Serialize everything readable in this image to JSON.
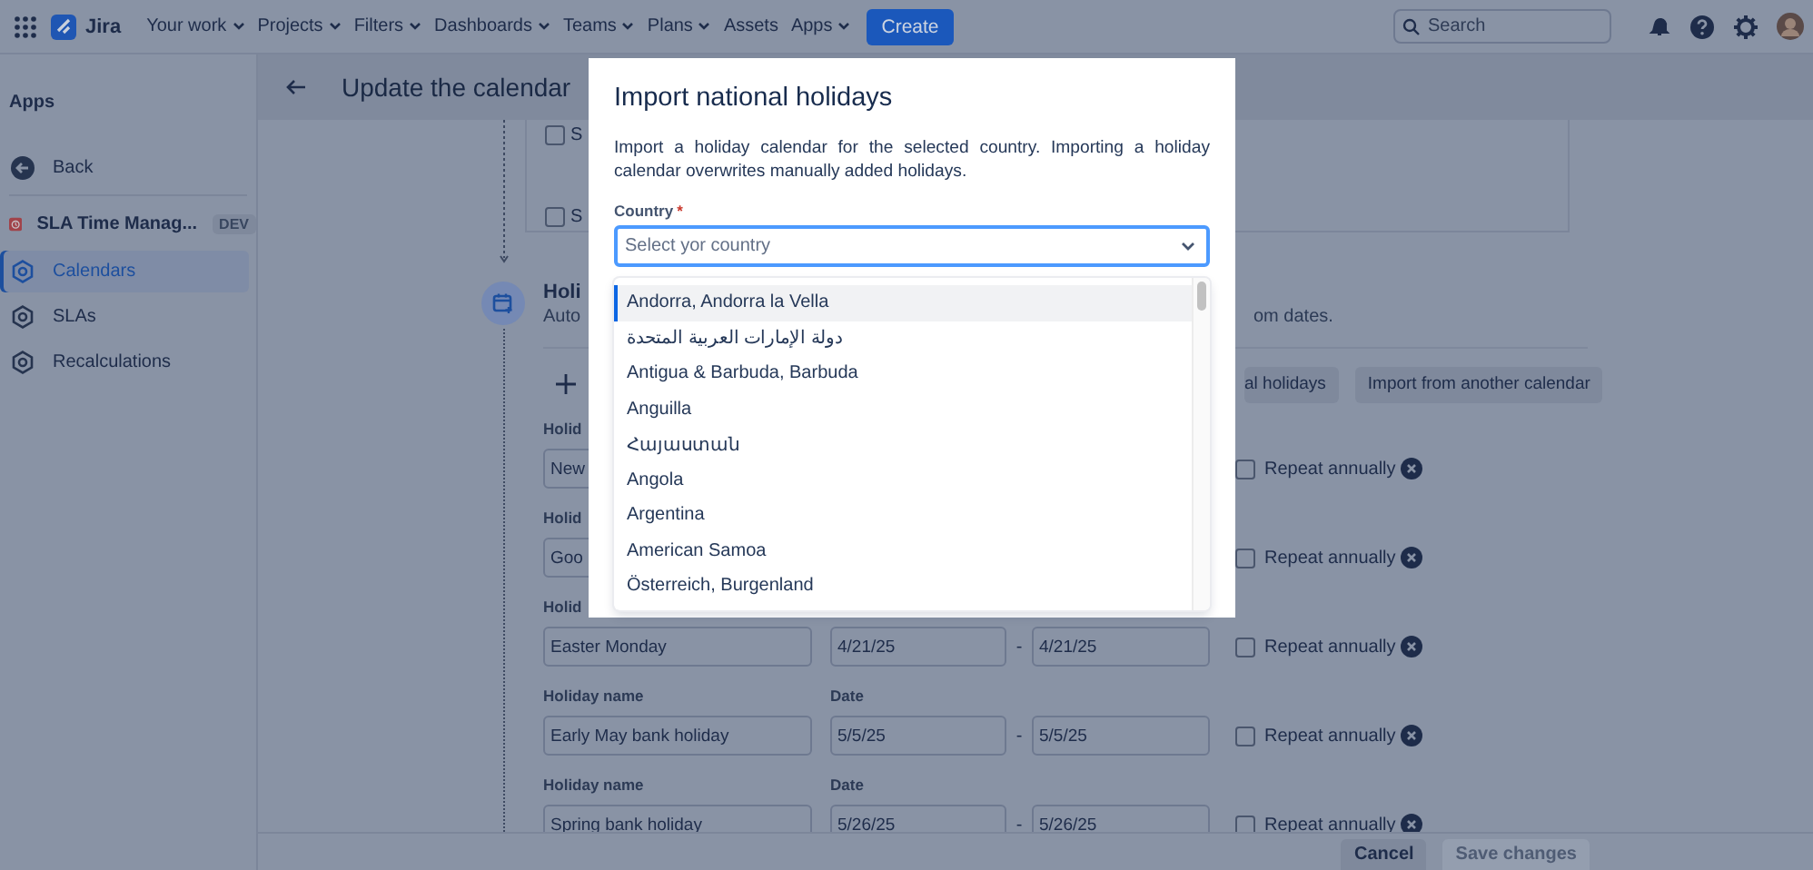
{
  "topbar": {
    "product": "Jira",
    "nav": [
      {
        "label": "Your work",
        "dropdown": true
      },
      {
        "label": "Projects",
        "dropdown": true
      },
      {
        "label": "Filters",
        "dropdown": true
      },
      {
        "label": "Dashboards",
        "dropdown": true
      },
      {
        "label": "Teams",
        "dropdown": true
      },
      {
        "label": "Plans",
        "dropdown": true
      },
      {
        "label": "Assets",
        "dropdown": false
      },
      {
        "label": "Apps",
        "dropdown": true
      }
    ],
    "create_button": "Create",
    "search": {
      "placeholder": "Search"
    }
  },
  "sidebar": {
    "heading": "Apps",
    "back": "Back",
    "app": {
      "name": "SLA Time Manag...",
      "badge": "DEV"
    },
    "items": [
      {
        "label": "Calendars",
        "selected": true
      },
      {
        "label": "SLAs",
        "selected": false
      },
      {
        "label": "Recalculations",
        "selected": false
      }
    ]
  },
  "page": {
    "title": "Update the calendar"
  },
  "working_days": [
    {
      "label": "S",
      "checked": false
    },
    {
      "label": "S",
      "checked": false
    }
  ],
  "holidays_section": {
    "title": "Holi",
    "subtitle_start": "Auto",
    "subtitle_end": "om dates.",
    "buttons": [
      "al holidays",
      "Import from another calendar"
    ]
  },
  "holiday_rows": [
    {
      "name_label": "Holid",
      "name": "New",
      "repeat_label": "Repeat annually",
      "repeat_checked": false
    },
    {
      "name_label": "Holid",
      "name": "Goo",
      "repeat_label": "Repeat annually",
      "repeat_checked": false
    },
    {
      "name_label": "Holid",
      "name": "Easter Monday",
      "date_from": "4/21/25",
      "separator": "-",
      "date_to": "4/21/25",
      "repeat_label": "Repeat annually",
      "repeat_checked": false
    },
    {
      "name_label": "Holiday name",
      "date_label": "Date",
      "name": "Early May bank holiday",
      "date_from": "5/5/25",
      "separator": "-",
      "date_to": "5/5/25",
      "repeat_label": "Repeat annually",
      "repeat_checked": false
    },
    {
      "name_label": "Holiday name",
      "date_label": "Date",
      "name": "Spring bank holiday",
      "date_from": "5/26/25",
      "separator": "-",
      "date_to": "5/26/25",
      "repeat_label": "Repeat annually",
      "repeat_checked": false
    }
  ],
  "footer": {
    "buttons": [
      {
        "label": "Cancel",
        "disabled": false
      },
      {
        "label": "Save changes",
        "disabled": true
      }
    ]
  },
  "modal": {
    "title": "Import national holidays",
    "description": "Import a holiday calendar for the selected country. Importing a holiday calendar overwrites manually added holidays.",
    "country": {
      "label": "Country",
      "required_mark": "*",
      "placeholder": "Select yor country"
    },
    "options": [
      {
        "label": "Andorra, Andorra la Vella",
        "selected": true
      },
      {
        "label": "دولة الإمارات العربية المتحدة",
        "selected": false
      },
      {
        "label": "Antigua & Barbuda, Barbuda",
        "selected": false
      },
      {
        "label": "Anguilla",
        "selected": false
      },
      {
        "label": "Հայաստան",
        "selected": false
      },
      {
        "label": "Angola",
        "selected": false
      },
      {
        "label": "Argentina",
        "selected": false
      },
      {
        "label": "American Samoa",
        "selected": false
      },
      {
        "label": "Österreich, Burgenland",
        "selected": false
      }
    ]
  }
}
